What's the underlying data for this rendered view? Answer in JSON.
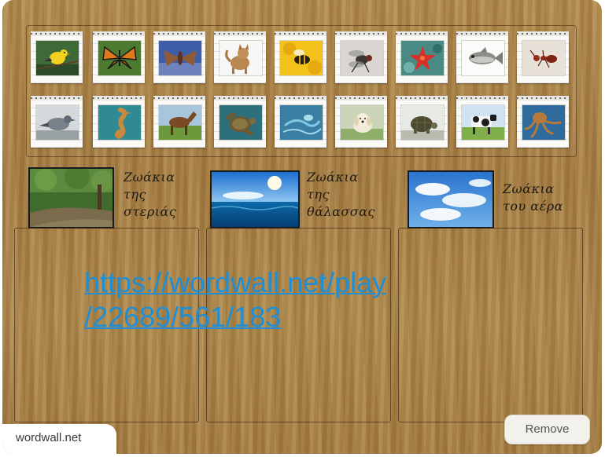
{
  "activity": {
    "cards": [
      {
        "name": "bird"
      },
      {
        "name": "butterfly"
      },
      {
        "name": "moth"
      },
      {
        "name": "cat"
      },
      {
        "name": "bee"
      },
      {
        "name": "fly"
      },
      {
        "name": "starfish"
      },
      {
        "name": "fish"
      },
      {
        "name": "ant"
      },
      {
        "name": "pigeon"
      },
      {
        "name": "seahorse"
      },
      {
        "name": "horse"
      },
      {
        "name": "sea-turtle"
      },
      {
        "name": "jellyfish"
      },
      {
        "name": "dog"
      },
      {
        "name": "tortoise"
      },
      {
        "name": "cow"
      },
      {
        "name": "octopus"
      }
    ],
    "groups": [
      {
        "line1": "Ζωάκια",
        "line2": "της",
        "line3": "στεριάς"
      },
      {
        "line1": "Ζωάκια",
        "line2": "της",
        "line3": "θάλασσας"
      },
      {
        "line1": "Ζωάκια",
        "line2": "του αέρα",
        "line3": ""
      }
    ],
    "link_line1": "https://wordwall.net/play",
    "link_line2": "/22689/561/183"
  },
  "footer": {
    "brand": "wordwall.net",
    "remove_label": "Remove"
  }
}
